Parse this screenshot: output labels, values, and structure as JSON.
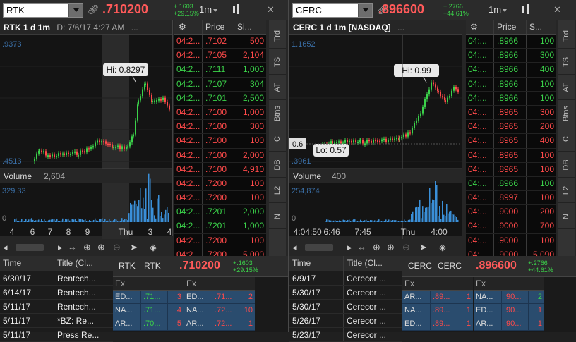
{
  "left": {
    "symbol": "RTK",
    "price": ".710200",
    "change": "+.1603",
    "change_pct": "+29.15%",
    "timeframe": "1m",
    "chart_title": "RTK 1 d 1m",
    "chart_date": "D: 7/6/17 4:27 AM",
    "more": "...",
    "price_top": ".9373",
    "price_bottom": ".4513",
    "hi_label": "Hi: 0.8297",
    "volume_label": "Volume",
    "volume_value": "2,604",
    "volume_max": "329.33",
    "volume_zero": "0",
    "x_labels": [
      "4",
      "6",
      "7",
      "8",
      "9",
      "Thu",
      "3",
      "4"
    ],
    "ts_headers": [
      "",
      "Price",
      "Si..."
    ],
    "ts_rows": [
      {
        "t": "04:2...",
        "p": ".7102",
        "s": "500",
        "up": false
      },
      {
        "t": "04:2...",
        "p": ".7105",
        "s": "2,104",
        "up": false
      },
      {
        "t": "04:2...",
        "p": ".7111",
        "s": "1,000",
        "up": true
      },
      {
        "t": "04:2...",
        "p": ".7107",
        "s": "304",
        "up": true
      },
      {
        "t": "04:2...",
        "p": ".7101",
        "s": "2,500",
        "up": true
      },
      {
        "t": "04:2...",
        "p": ".7100",
        "s": "1,000",
        "up": false
      },
      {
        "t": "04:2...",
        "p": ".7100",
        "s": "300",
        "up": false
      },
      {
        "t": "04:2...",
        "p": ".7100",
        "s": "100",
        "up": false
      },
      {
        "t": "04:2...",
        "p": ".7100",
        "s": "2,000",
        "up": false
      },
      {
        "t": "04:2...",
        "p": ".7100",
        "s": "4,910",
        "up": false
      },
      {
        "t": "04:2...",
        "p": ".7200",
        "s": "100",
        "up": false
      },
      {
        "t": "04:2...",
        "p": ".7200",
        "s": "100",
        "up": false
      },
      {
        "t": "04:2...",
        "p": ".7201",
        "s": "2,000",
        "up": true
      },
      {
        "t": "04:2...",
        "p": ".7201",
        "s": "1,000",
        "up": true
      },
      {
        "t": "04:2...",
        "p": ".7200",
        "s": "100",
        "up": false
      },
      {
        "t": "04:2...",
        "p": ".7200",
        "s": "5,000",
        "up": false
      },
      {
        "t": "04:2...",
        "p": ".720",
        "s": "400",
        "up": false
      }
    ],
    "news_headers": [
      "Time",
      "Title (Cl..."
    ],
    "news_rows": [
      {
        "t": "6/30/17",
        "title": "Rentech..."
      },
      {
        "t": "6/14/17",
        "title": "Rentech..."
      },
      {
        "t": "5/11/17",
        "title": "Rentech..."
      },
      {
        "t": "5/11/17",
        "title": "*BZ: Re..."
      },
      {
        "t": "5/11/17",
        "title": "Press Re..."
      }
    ],
    "l2_tab1": "RTK",
    "l2_tab2": "RTK",
    "l2_price": ".710200",
    "l2_chg": "+.1603",
    "l2_pct": "+29.15%",
    "bid_rows": [
      {
        "ex": "ED...",
        "p": ".71...",
        "s": "3"
      },
      {
        "ex": "NA...",
        "p": ".71...",
        "s": "4"
      },
      {
        "ex": "AR...",
        "p": ".70...",
        "s": "5"
      }
    ],
    "ask_rows": [
      {
        "ex": "ED...",
        "p": ".71...",
        "s": "2"
      },
      {
        "ex": "NA...",
        "p": ".72...",
        "s": "10"
      },
      {
        "ex": "AR...",
        "p": ".72...",
        "s": "1"
      }
    ],
    "ex_label": "Ex"
  },
  "right": {
    "symbol": "CERC",
    "price": ".896600",
    "change": "+.2766",
    "change_pct": "+44.61%",
    "timeframe": "1m",
    "chart_title": "CERC 1 d 1m [NASDAQ]",
    "more": "...",
    "price_top": "1.1652",
    "price_bottom": ".3961",
    "hi_label": "Hi: 0.99",
    "lo_label": "Lo: 0.57",
    "level_label": "0.6",
    "volume_label": "Volume",
    "volume_value": "400",
    "volume_max": "254,874",
    "volume_zero": "0",
    "x_labels": [
      "4:0",
      "4:50",
      "6:46",
      "7:45",
      "Thu",
      "4:00"
    ],
    "ts_headers": [
      "",
      "Price",
      "S..."
    ],
    "ts_rows": [
      {
        "t": "04:...",
        "p": ".8966",
        "s": "100",
        "up": true
      },
      {
        "t": "04:...",
        "p": ".8966",
        "s": "300",
        "up": true
      },
      {
        "t": "04:...",
        "p": ".8966",
        "s": "400",
        "up": true
      },
      {
        "t": "04:...",
        "p": ".8966",
        "s": "100",
        "up": true
      },
      {
        "t": "04:...",
        "p": ".8966",
        "s": "100",
        "up": true
      },
      {
        "t": "04:...",
        "p": ".8965",
        "s": "300",
        "up": false
      },
      {
        "t": "04:...",
        "p": ".8965",
        "s": "200",
        "up": false
      },
      {
        "t": "04:...",
        "p": ".8965",
        "s": "400",
        "up": false
      },
      {
        "t": "04:...",
        "p": ".8965",
        "s": "100",
        "up": false
      },
      {
        "t": "04:...",
        "p": ".8965",
        "s": "100",
        "up": false
      },
      {
        "t": "04:...",
        "p": ".8966",
        "s": "100",
        "up": true
      },
      {
        "t": "04:...",
        "p": ".8997",
        "s": "100",
        "up": false
      },
      {
        "t": "04:...",
        "p": ".9000",
        "s": "200",
        "up": false
      },
      {
        "t": "04:...",
        "p": ".9000",
        "s": "700",
        "up": false
      },
      {
        "t": "04:...",
        "p": ".9000",
        "s": "100",
        "up": false
      },
      {
        "t": "04:...",
        "p": ".9000",
        "s": "5,090",
        "up": false
      },
      {
        "t": "04:...",
        "p": ".9000",
        "s": "100",
        "up": false
      }
    ],
    "news_headers": [
      "Time",
      "Title (Cl..."
    ],
    "news_rows": [
      {
        "t": "6/9/17",
        "title": "Cerecor ..."
      },
      {
        "t": "5/30/17",
        "title": "Cerecor ..."
      },
      {
        "t": "5/30/17",
        "title": "Cerecor ..."
      },
      {
        "t": "5/26/17",
        "title": "Cerecor ..."
      },
      {
        "t": "5/23/17",
        "title": "Cerecor ..."
      }
    ],
    "l2_tab1": "CERC",
    "l2_tab2": "CERC",
    "l2_price": ".896600",
    "l2_chg": "+.2766",
    "l2_pct": "+44.61%",
    "bid_rows": [
      {
        "ex": "AR...",
        "p": ".89...",
        "s": "1"
      },
      {
        "ex": "NA...",
        "p": ".89...",
        "s": "1"
      },
      {
        "ex": "ED...",
        "p": ".89...",
        "s": "1"
      }
    ],
    "ask_rows": [
      {
        "ex": "NA...",
        "p": ".90...",
        "s": "2"
      },
      {
        "ex": "ED...",
        "p": ".90...",
        "s": "1"
      },
      {
        "ex": "AR...",
        "p": ".90...",
        "s": "1"
      }
    ],
    "ex_label": "Ex"
  },
  "side_tabs": [
    "Trd",
    "TS",
    "AT",
    "Btns",
    "C",
    "DB",
    "L2",
    "N"
  ],
  "colors": {
    "up": "#3bd24a",
    "down": "#ff4a4a",
    "book_bg": "#2a4c6e"
  }
}
